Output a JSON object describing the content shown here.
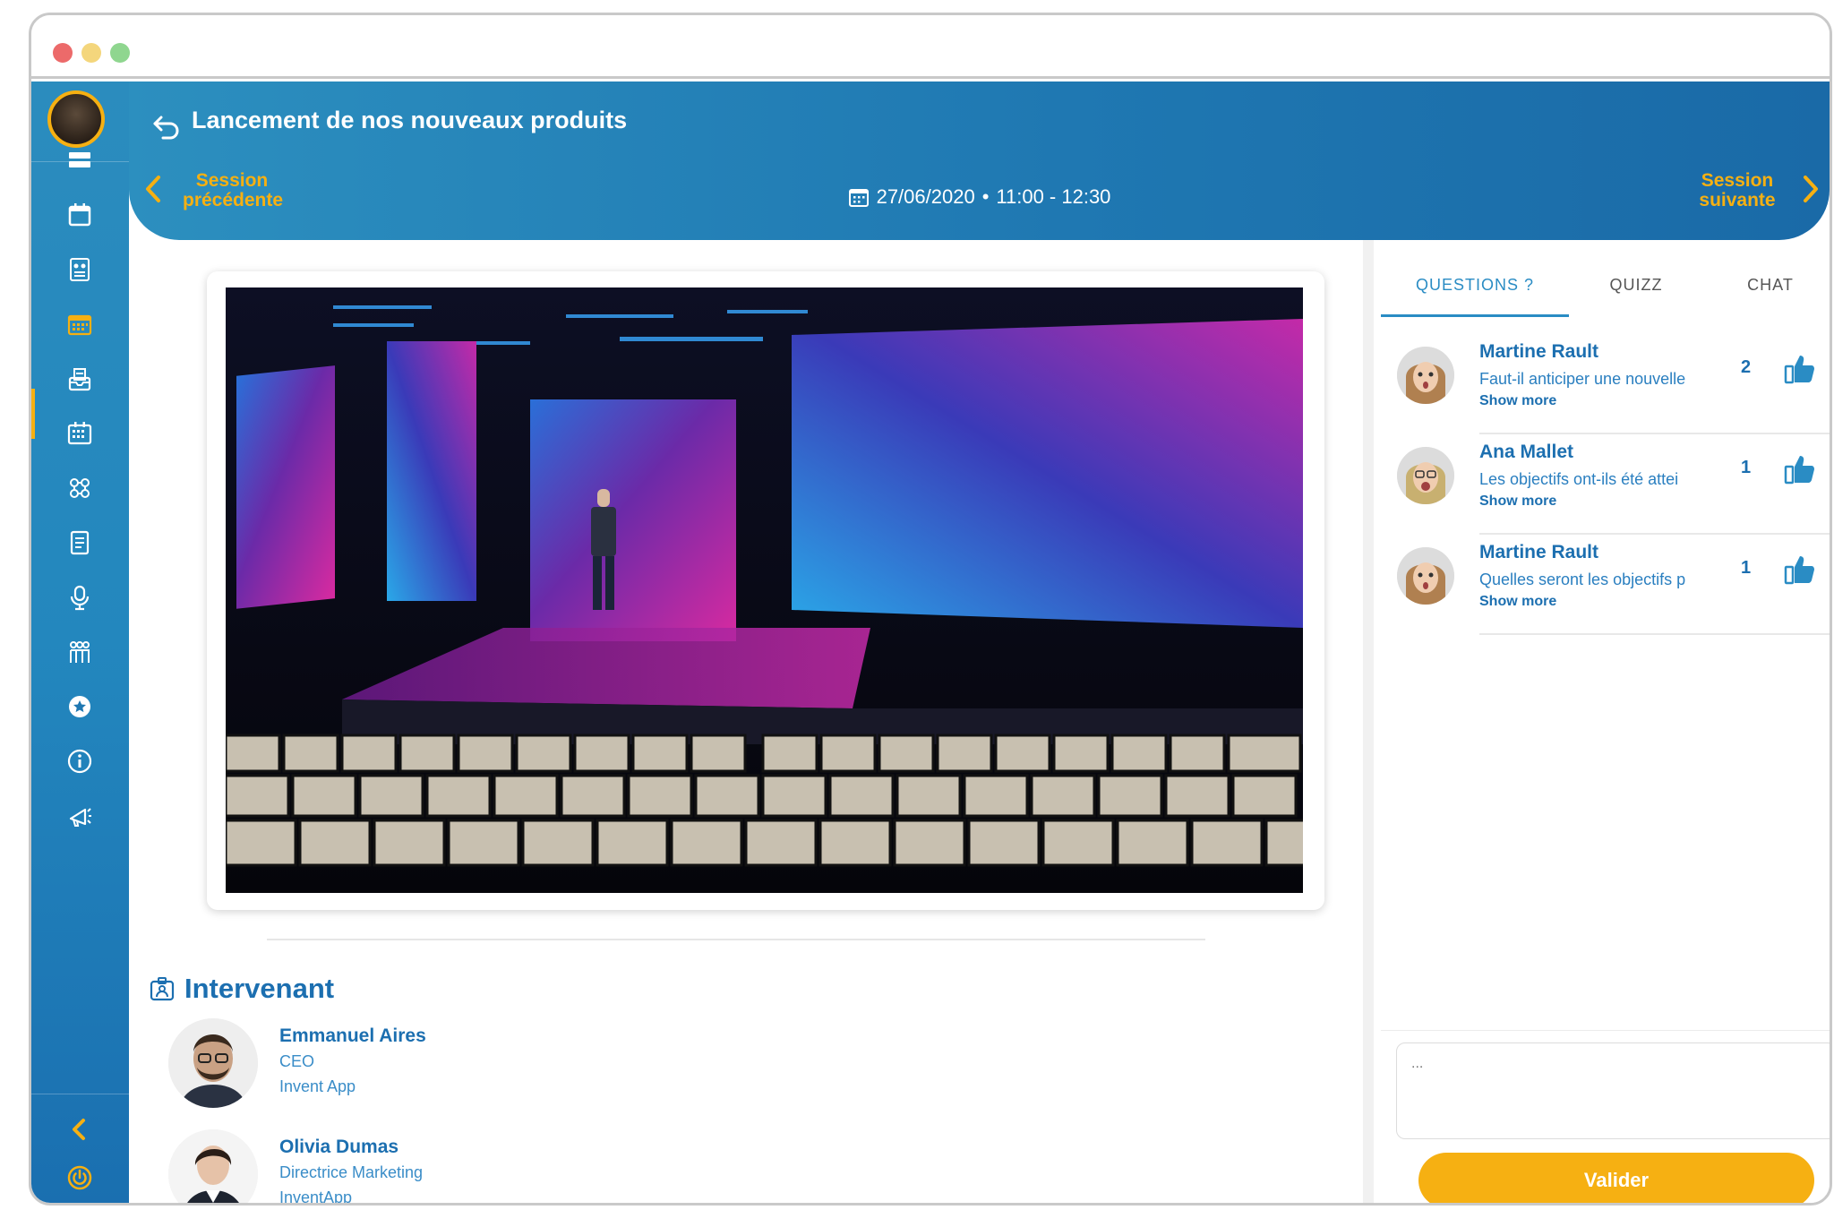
{
  "window": {
    "dot_colors": [
      "#ec6a6a",
      "#f4d67c",
      "#8fd68f"
    ]
  },
  "header": {
    "title": "Lancement de nos nouveaux produits",
    "prev_line1": "Session",
    "prev_line2": "précédente",
    "next_line1": "Session",
    "next_line2": "suivante",
    "date": "27/06/2020",
    "separator": "•",
    "time": "11:00 - 12:30"
  },
  "sidebar": {
    "icons": [
      "list-icon",
      "calendar-icon",
      "program-icon",
      "agenda-icon",
      "inbox-icon",
      "schedule-icon",
      "network-icon",
      "document-icon",
      "microphone-icon",
      "people-icon",
      "star-icon",
      "info-icon",
      "megaphone-icon",
      "collapse-icon",
      "power-icon"
    ],
    "active_index": 3
  },
  "speakers": {
    "title": "Intervenant",
    "items": [
      {
        "name": "Emmanuel Aires",
        "role": "CEO",
        "org": "Invent App"
      },
      {
        "name": "Olivia Dumas",
        "role": "Directrice Marketing",
        "org": "InventApp"
      }
    ]
  },
  "panel": {
    "tabs": [
      "QUESTIONS ?",
      "QUIZZ",
      "CHAT"
    ],
    "active_tab": 0,
    "questions": [
      {
        "name": "Martine Rault",
        "text": "Faut-il anticiper une nouvelle",
        "more": "Show more",
        "likes": "2"
      },
      {
        "name": "Ana Mallet",
        "text": "Les objectifs ont-ils été attei",
        "more": "Show more",
        "likes": "1"
      },
      {
        "name": "Martine Rault",
        "text": "Quelles seront les objectifs p",
        "more": "Show more",
        "likes": "1"
      }
    ],
    "input_placeholder": "...",
    "submit_label": "Valider"
  },
  "colors": {
    "primary": "#1c6fb0",
    "accent": "#f6b012",
    "header_start": "#2c8fbf",
    "header_end": "#1a6aa7"
  }
}
